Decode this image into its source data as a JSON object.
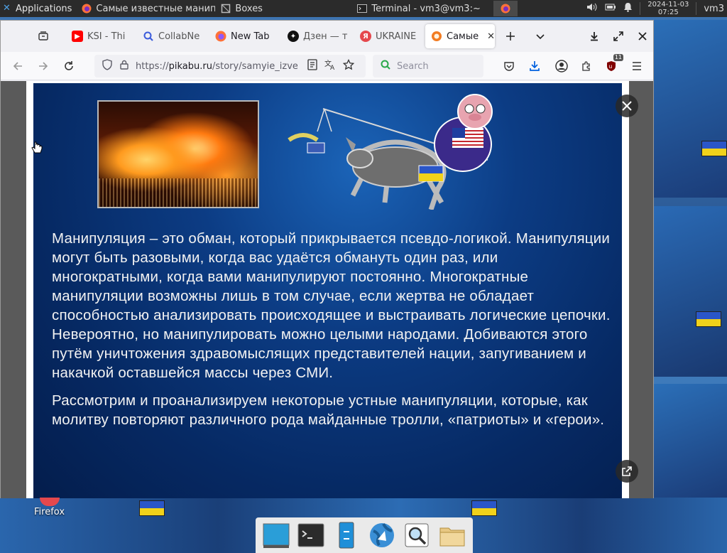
{
  "top_panel": {
    "applications_label": "Applications",
    "tasks": [
      {
        "label": "Самые известные манип...",
        "icon": "firefox-icon",
        "active": false
      },
      {
        "label": "Boxes",
        "icon": "boxes-icon",
        "active": false
      },
      {
        "label": "Terminal - vm3@vm3:~",
        "icon": "terminal-icon",
        "active": false
      },
      {
        "label": "",
        "icon": "firefox-icon",
        "active": true
      }
    ],
    "clock_date": "2024-11-03",
    "clock_time": "07:25",
    "user": "vm3"
  },
  "browser": {
    "tabs": [
      {
        "label": "KSI - Thi",
        "favicon": "youtube-icon",
        "color": "#ff0000"
      },
      {
        "label": "CollabNe",
        "favicon": "search-icon",
        "color": "#3b5bdb"
      },
      {
        "label": "New Tab",
        "favicon": "firefox-icon",
        "color": "#ff7139"
      },
      {
        "label": "Дзен — т",
        "favicon": "dzen-icon",
        "color": "#111111"
      },
      {
        "label": "UKRAINE",
        "favicon": "yandex-icon",
        "color": "#e5484d"
      },
      {
        "label": "Самые",
        "favicon": "pikabu-icon",
        "color": "#f27c22",
        "selected": true
      }
    ],
    "url_prefix": "https://",
    "url_host": "pikabu.ru",
    "url_path": "/story/samyie_izvest",
    "search_placeholder": "Search",
    "extension_badge": "11"
  },
  "slide": {
    "paragraph1": "Манипуляция – это обман, который прикрывается псевдо-логикой. Манипуляции могут быть разовыми, когда вас удаётся обмануть один раз, или многократными, когда вами манипулируют постоянно. Многократные манипуляции возможны лишь в том случае, если жертва не обладает способностью анализировать происходящее и выстраивать логические цепочки. Невероятно, но манипулировать можно целыми народами. Добиваются этого путём уничтожения здравомыслящих представителей нации, запугиванием и накачкой оставшейся массы через СМИ.",
    "paragraph2": "Рассмотрим и проанализируем некоторые устные манипуляции, которые, как молитву повторяют различного рода майданные тролли, «патриоты» и «герои»."
  },
  "desktop": {
    "firefox_label": "Firefox"
  },
  "dock": {
    "items": [
      "show-desktop-icon",
      "terminal-icon",
      "file-manager-icon",
      "web-browser-icon",
      "app-finder-icon",
      "folder-icon"
    ]
  },
  "colors": {
    "accent": "#0060df",
    "slide_bg": "#0c3c84"
  }
}
